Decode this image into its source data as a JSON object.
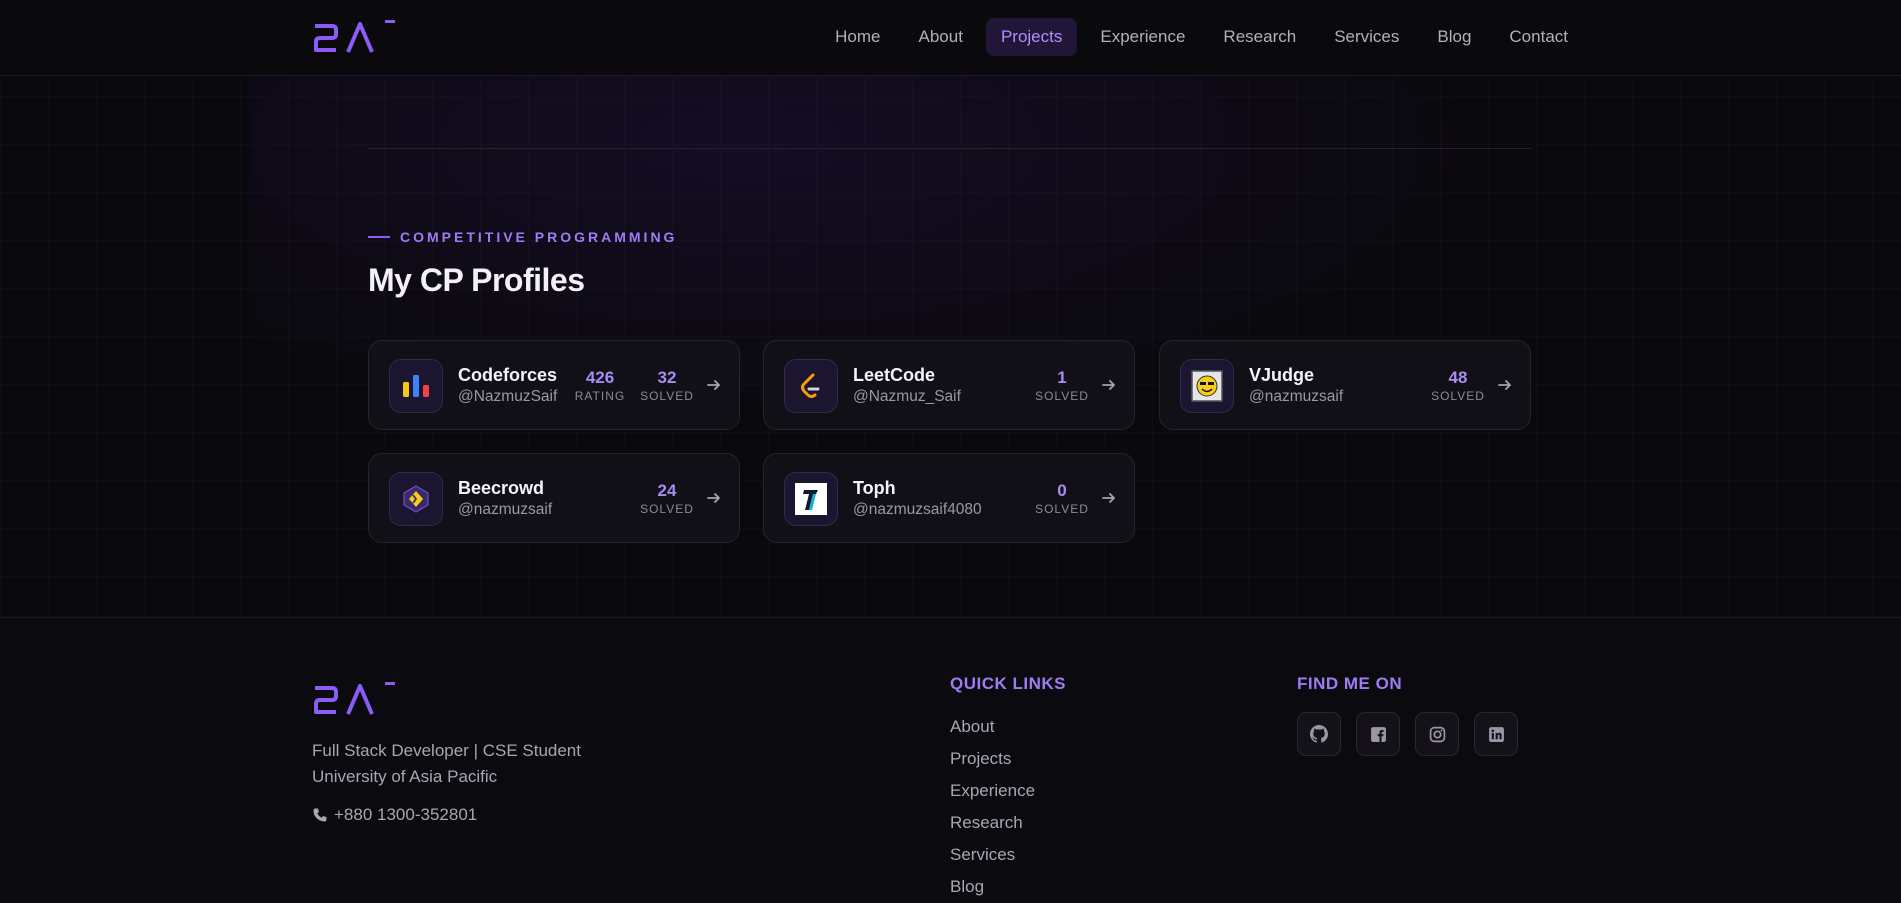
{
  "nav": {
    "items": [
      {
        "label": "Home"
      },
      {
        "label": "About"
      },
      {
        "label": "Projects",
        "active": true
      },
      {
        "label": "Experience"
      },
      {
        "label": "Research"
      },
      {
        "label": "Services"
      },
      {
        "label": "Blog"
      },
      {
        "label": "Contact"
      }
    ]
  },
  "section": {
    "eyebrow": "COMPETITIVE PROGRAMMING",
    "title": "My CP Profiles"
  },
  "profiles": [
    {
      "name": "Codeforces",
      "handle": "@NazmuzSaif",
      "icon": "codeforces-icon",
      "stats": [
        {
          "value": "426",
          "label": "RATING"
        },
        {
          "value": "32",
          "label": "SOLVED"
        }
      ]
    },
    {
      "name": "LeetCode",
      "handle": "@Nazmuz_Saif",
      "icon": "leetcode-icon",
      "stats": [
        {
          "value": "1",
          "label": "SOLVED"
        }
      ]
    },
    {
      "name": "VJudge",
      "handle": "@nazmuzsaif",
      "icon": "vjudge-icon",
      "stats": [
        {
          "value": "48",
          "label": "SOLVED"
        }
      ]
    },
    {
      "name": "Beecrowd",
      "handle": "@nazmuzsaif",
      "icon": "beecrowd-icon",
      "stats": [
        {
          "value": "24",
          "label": "SOLVED"
        }
      ]
    },
    {
      "name": "Toph",
      "handle": "@nazmuzsaif4080",
      "icon": "toph-icon",
      "stats": [
        {
          "value": "0",
          "label": "SOLVED"
        }
      ]
    }
  ],
  "footer": {
    "tagline_line1": "Full Stack Developer | CSE Student",
    "tagline_line2": "University of Asia Pacific",
    "phone": "+880 1300-352801",
    "quick_links_title": "QUICK LINKS",
    "quick_links": [
      "About",
      "Projects",
      "Experience",
      "Research",
      "Services",
      "Blog"
    ],
    "find_me_title": "FIND ME ON",
    "socials": [
      "github-icon",
      "facebook-icon",
      "instagram-icon",
      "linkedin-icon"
    ]
  },
  "colors": {
    "accent": "#8b5cf6",
    "background": "#0a090d",
    "card": "#121017"
  }
}
